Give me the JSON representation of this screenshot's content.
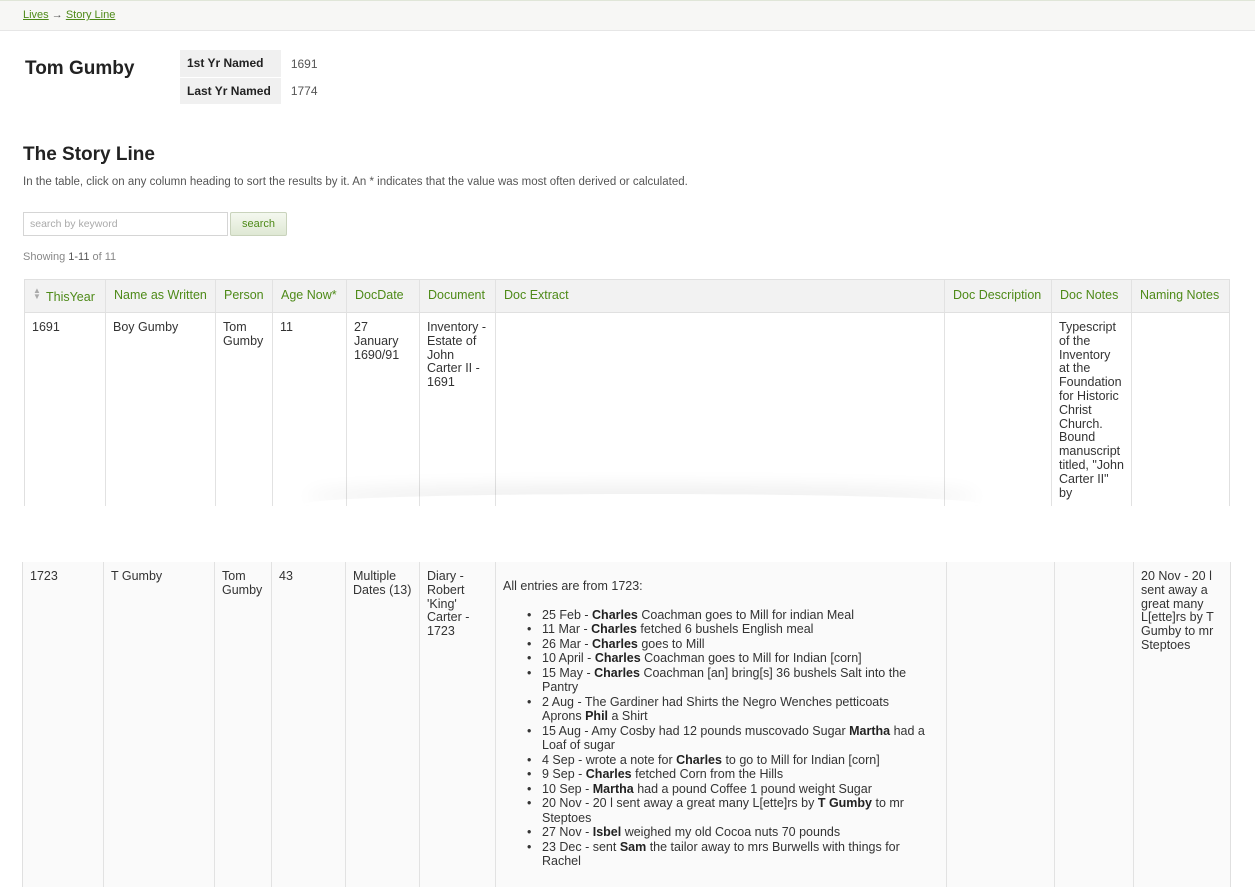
{
  "breadcrumb": {
    "lives": "Lives",
    "arrow": "→",
    "storyline": "Story Line"
  },
  "person": {
    "name": "Tom Gumby",
    "first_label": "1st Yr Named",
    "first_value": "1691",
    "last_label": "Last Yr Named",
    "last_value": "1774"
  },
  "section": {
    "title": "The Story Line",
    "intro": "In the table, click on any column heading to sort the results by it. An * indicates that the value was most often derived or calculated."
  },
  "search": {
    "placeholder": "search by keyword",
    "button": "search"
  },
  "showing": {
    "prefix": "Showing ",
    "range": "1-11",
    "suffix": " of 11"
  },
  "table": {
    "columns": [
      "ThisYear",
      "Name as Written",
      "Person",
      "Age Now*",
      "DocDate",
      "Document",
      "Doc Extract",
      "Doc Description",
      "Doc Notes",
      "Naming Notes"
    ],
    "rows": [
      {
        "this_year": "1691",
        "name_written": "Boy Gumby",
        "person": "Tom Gumby",
        "age_now": "11",
        "doc_date": "27 January 1690/91",
        "document": "Inventory - Estate of John Carter II - 1691",
        "doc_extract": "",
        "doc_description": "",
        "doc_notes": "Typescript of the Inventory at the Foundation for Historic Christ Church. Bound manuscript titled, \"John Carter II\" by",
        "naming_notes": ""
      },
      {
        "this_year": "1723",
        "name_written": "T Gumby",
        "person": "Tom Gumby",
        "age_now": "43",
        "doc_date": "Multiple Dates (13)",
        "document": "Diary - Robert 'King' Carter - 1723",
        "doc_extract_intro": "All entries are from 1723:",
        "doc_extract_entries": [
          {
            "before": "25 Feb - ",
            "bold": "Charles",
            "after": " Coachman goes to Mill for indian Meal"
          },
          {
            "before": "11 Mar - ",
            "bold": "Charles",
            "after": " fetched 6 bushels English meal"
          },
          {
            "before": "26 Mar - ",
            "bold": "Charles",
            "after": " goes to Mill"
          },
          {
            "before": "10 April - ",
            "bold": "Charles",
            "after": " Coachman goes to Mill for Indian [corn]"
          },
          {
            "before": "15 May - ",
            "bold": "Charles",
            "after": " Coachman [an] bring[s] 36 bushels Salt into the Pantry"
          },
          {
            "before": "2 Aug - The Gardiner had Shirts the Negro Wenches petticoats Aprons ",
            "bold": "Phil",
            "after": " a Shirt"
          },
          {
            "before": "15 Aug - Amy Cosby had 12 pounds muscovado Sugar ",
            "bold": "Martha",
            "after": " had a Loaf of sugar"
          },
          {
            "before": "4 Sep - wrote a note for ",
            "bold": "Charles",
            "after": " to go to Mill for Indian [corn]"
          },
          {
            "before": "9 Sep - ",
            "bold": "Charles",
            "after": " fetched Corn from the Hills"
          },
          {
            "before": "10 Sep - ",
            "bold": "Martha",
            "after": " had a pound Coffee 1 pound weight Sugar"
          },
          {
            "before": "20 Nov - 20 l sent away a great many L[ette]rs by ",
            "bold": "T Gumby",
            "after": " to mr Steptoes"
          },
          {
            "before": "27 Nov - ",
            "bold": "Isbel",
            "after": " weighed my old Cocoa nuts 70 pounds"
          },
          {
            "before": "23 Dec - sent ",
            "bold": "Sam",
            "after": " the tailor away to mrs Burwells with things for Rachel"
          }
        ],
        "doc_description": "",
        "doc_notes": "",
        "naming_notes": "20 Nov - 20 l sent away a great many L[ette]rs by T Gumby to mr Steptoes"
      }
    ]
  }
}
